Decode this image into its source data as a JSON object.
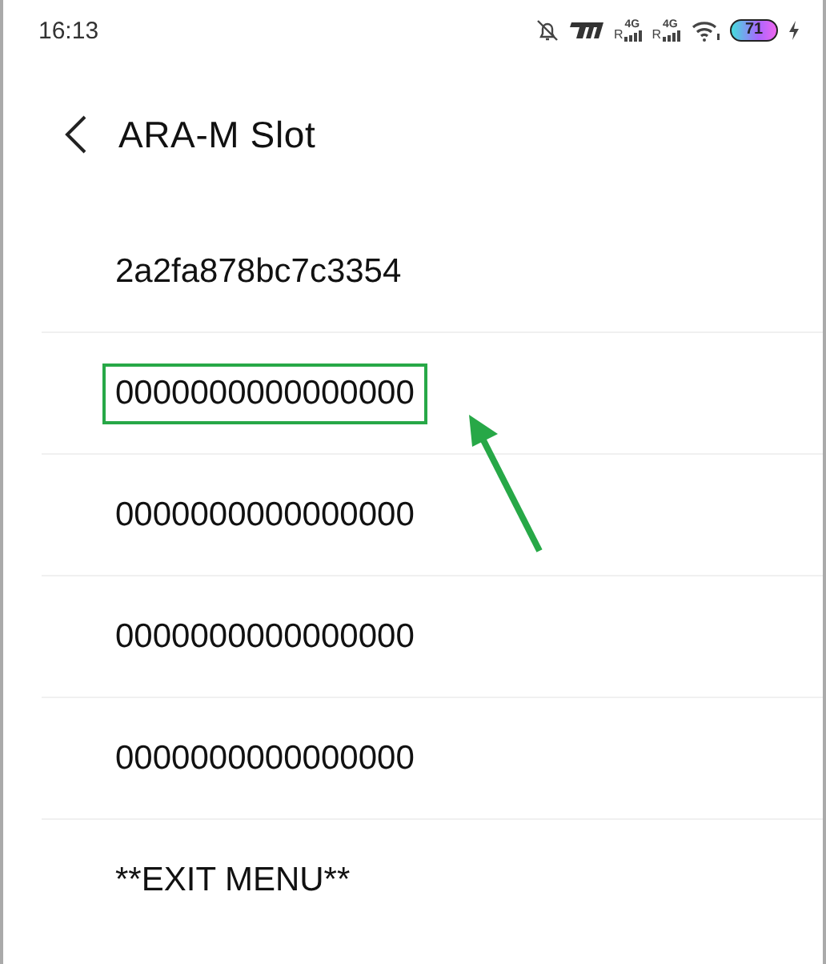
{
  "status_bar": {
    "time": "16:13",
    "signals": [
      {
        "roaming": "R",
        "network": "4G"
      },
      {
        "roaming": "R",
        "network": "4G"
      }
    ],
    "battery": "71"
  },
  "header": {
    "title": "ARA-M Slot"
  },
  "items": [
    {
      "label": "2a2fa878bc7c3354",
      "highlighted": false
    },
    {
      "label": "0000000000000000",
      "highlighted": true
    },
    {
      "label": "0000000000000000",
      "highlighted": false
    },
    {
      "label": "0000000000000000",
      "highlighted": false
    },
    {
      "label": "0000000000000000",
      "highlighted": false
    },
    {
      "label": "**EXIT MENU**",
      "highlighted": false
    }
  ]
}
